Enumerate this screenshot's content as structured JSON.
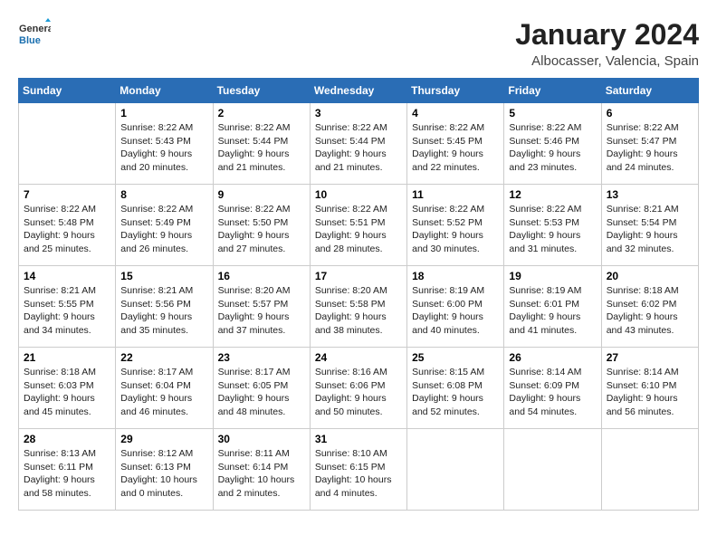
{
  "header": {
    "logo_general": "General",
    "logo_blue": "Blue",
    "month": "January 2024",
    "location": "Albocasser, Valencia, Spain"
  },
  "days_of_week": [
    "Sunday",
    "Monday",
    "Tuesday",
    "Wednesday",
    "Thursday",
    "Friday",
    "Saturday"
  ],
  "weeks": [
    [
      {
        "day": "",
        "sunrise": "",
        "sunset": "",
        "daylight": ""
      },
      {
        "day": "1",
        "sunrise": "Sunrise: 8:22 AM",
        "sunset": "Sunset: 5:43 PM",
        "daylight": "Daylight: 9 hours and 20 minutes."
      },
      {
        "day": "2",
        "sunrise": "Sunrise: 8:22 AM",
        "sunset": "Sunset: 5:44 PM",
        "daylight": "Daylight: 9 hours and 21 minutes."
      },
      {
        "day": "3",
        "sunrise": "Sunrise: 8:22 AM",
        "sunset": "Sunset: 5:44 PM",
        "daylight": "Daylight: 9 hours and 21 minutes."
      },
      {
        "day": "4",
        "sunrise": "Sunrise: 8:22 AM",
        "sunset": "Sunset: 5:45 PM",
        "daylight": "Daylight: 9 hours and 22 minutes."
      },
      {
        "day": "5",
        "sunrise": "Sunrise: 8:22 AM",
        "sunset": "Sunset: 5:46 PM",
        "daylight": "Daylight: 9 hours and 23 minutes."
      },
      {
        "day": "6",
        "sunrise": "Sunrise: 8:22 AM",
        "sunset": "Sunset: 5:47 PM",
        "daylight": "Daylight: 9 hours and 24 minutes."
      }
    ],
    [
      {
        "day": "7",
        "sunrise": "Sunrise: 8:22 AM",
        "sunset": "Sunset: 5:48 PM",
        "daylight": "Daylight: 9 hours and 25 minutes."
      },
      {
        "day": "8",
        "sunrise": "Sunrise: 8:22 AM",
        "sunset": "Sunset: 5:49 PM",
        "daylight": "Daylight: 9 hours and 26 minutes."
      },
      {
        "day": "9",
        "sunrise": "Sunrise: 8:22 AM",
        "sunset": "Sunset: 5:50 PM",
        "daylight": "Daylight: 9 hours and 27 minutes."
      },
      {
        "day": "10",
        "sunrise": "Sunrise: 8:22 AM",
        "sunset": "Sunset: 5:51 PM",
        "daylight": "Daylight: 9 hours and 28 minutes."
      },
      {
        "day": "11",
        "sunrise": "Sunrise: 8:22 AM",
        "sunset": "Sunset: 5:52 PM",
        "daylight": "Daylight: 9 hours and 30 minutes."
      },
      {
        "day": "12",
        "sunrise": "Sunrise: 8:22 AM",
        "sunset": "Sunset: 5:53 PM",
        "daylight": "Daylight: 9 hours and 31 minutes."
      },
      {
        "day": "13",
        "sunrise": "Sunrise: 8:21 AM",
        "sunset": "Sunset: 5:54 PM",
        "daylight": "Daylight: 9 hours and 32 minutes."
      }
    ],
    [
      {
        "day": "14",
        "sunrise": "Sunrise: 8:21 AM",
        "sunset": "Sunset: 5:55 PM",
        "daylight": "Daylight: 9 hours and 34 minutes."
      },
      {
        "day": "15",
        "sunrise": "Sunrise: 8:21 AM",
        "sunset": "Sunset: 5:56 PM",
        "daylight": "Daylight: 9 hours and 35 minutes."
      },
      {
        "day": "16",
        "sunrise": "Sunrise: 8:20 AM",
        "sunset": "Sunset: 5:57 PM",
        "daylight": "Daylight: 9 hours and 37 minutes."
      },
      {
        "day": "17",
        "sunrise": "Sunrise: 8:20 AM",
        "sunset": "Sunset: 5:58 PM",
        "daylight": "Daylight: 9 hours and 38 minutes."
      },
      {
        "day": "18",
        "sunrise": "Sunrise: 8:19 AM",
        "sunset": "Sunset: 6:00 PM",
        "daylight": "Daylight: 9 hours and 40 minutes."
      },
      {
        "day": "19",
        "sunrise": "Sunrise: 8:19 AM",
        "sunset": "Sunset: 6:01 PM",
        "daylight": "Daylight: 9 hours and 41 minutes."
      },
      {
        "day": "20",
        "sunrise": "Sunrise: 8:18 AM",
        "sunset": "Sunset: 6:02 PM",
        "daylight": "Daylight: 9 hours and 43 minutes."
      }
    ],
    [
      {
        "day": "21",
        "sunrise": "Sunrise: 8:18 AM",
        "sunset": "Sunset: 6:03 PM",
        "daylight": "Daylight: 9 hours and 45 minutes."
      },
      {
        "day": "22",
        "sunrise": "Sunrise: 8:17 AM",
        "sunset": "Sunset: 6:04 PM",
        "daylight": "Daylight: 9 hours and 46 minutes."
      },
      {
        "day": "23",
        "sunrise": "Sunrise: 8:17 AM",
        "sunset": "Sunset: 6:05 PM",
        "daylight": "Daylight: 9 hours and 48 minutes."
      },
      {
        "day": "24",
        "sunrise": "Sunrise: 8:16 AM",
        "sunset": "Sunset: 6:06 PM",
        "daylight": "Daylight: 9 hours and 50 minutes."
      },
      {
        "day": "25",
        "sunrise": "Sunrise: 8:15 AM",
        "sunset": "Sunset: 6:08 PM",
        "daylight": "Daylight: 9 hours and 52 minutes."
      },
      {
        "day": "26",
        "sunrise": "Sunrise: 8:14 AM",
        "sunset": "Sunset: 6:09 PM",
        "daylight": "Daylight: 9 hours and 54 minutes."
      },
      {
        "day": "27",
        "sunrise": "Sunrise: 8:14 AM",
        "sunset": "Sunset: 6:10 PM",
        "daylight": "Daylight: 9 hours and 56 minutes."
      }
    ],
    [
      {
        "day": "28",
        "sunrise": "Sunrise: 8:13 AM",
        "sunset": "Sunset: 6:11 PM",
        "daylight": "Daylight: 9 hours and 58 minutes."
      },
      {
        "day": "29",
        "sunrise": "Sunrise: 8:12 AM",
        "sunset": "Sunset: 6:13 PM",
        "daylight": "Daylight: 10 hours and 0 minutes."
      },
      {
        "day": "30",
        "sunrise": "Sunrise: 8:11 AM",
        "sunset": "Sunset: 6:14 PM",
        "daylight": "Daylight: 10 hours and 2 minutes."
      },
      {
        "day": "31",
        "sunrise": "Sunrise: 8:10 AM",
        "sunset": "Sunset: 6:15 PM",
        "daylight": "Daylight: 10 hours and 4 minutes."
      },
      {
        "day": "",
        "sunrise": "",
        "sunset": "",
        "daylight": ""
      },
      {
        "day": "",
        "sunrise": "",
        "sunset": "",
        "daylight": ""
      },
      {
        "day": "",
        "sunrise": "",
        "sunset": "",
        "daylight": ""
      }
    ]
  ]
}
